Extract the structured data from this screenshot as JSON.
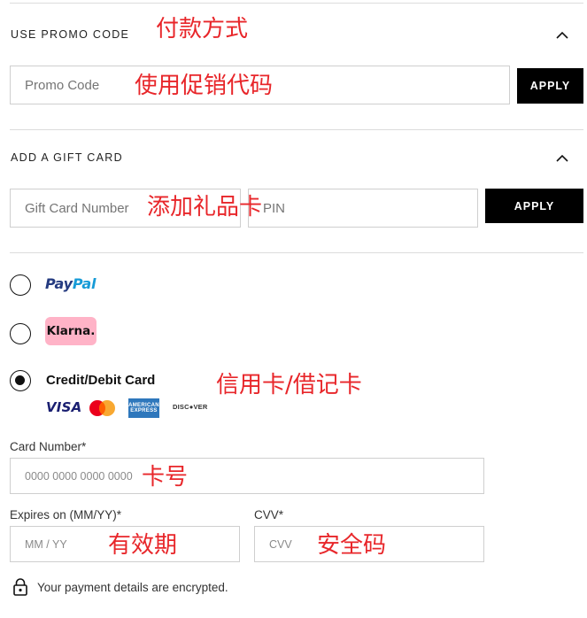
{
  "promo": {
    "title": "USE PROMO CODE",
    "annotation": "付款方式",
    "placeholder": "Promo Code",
    "input_annotation": "使用促销代码",
    "apply_label": "APPLY"
  },
  "gift_card": {
    "title": "ADD A GIFT CARD",
    "number_placeholder": "Gift Card Number",
    "annotation": "添加礼品卡",
    "pin_placeholder": "PIN",
    "apply_label": "APPLY"
  },
  "payment_methods": {
    "paypal": {
      "pay": "Pay",
      "pal": "Pal"
    },
    "klarna": {
      "label": "Klarna."
    },
    "card": {
      "label": "Credit/Debit Card",
      "annotation": "信用卡/借记卡",
      "logos": {
        "visa": "VISA",
        "amex_line1": "AMERICAN",
        "amex_line2": "EXPRESS",
        "discover": "DISC●VER"
      }
    },
    "selected": "card"
  },
  "card_form": {
    "number_label": "Card Number*",
    "number_placeholder": "0000 0000 0000 0000",
    "number_annotation": "卡号",
    "expiry_label": "Expires on (MM/YY)*",
    "expiry_placeholder": "MM / YY",
    "expiry_annotation": "有效期",
    "cvv_label": "CVV*",
    "cvv_placeholder": "CVV",
    "cvv_annotation": "安全码"
  },
  "secure_note": "Your payment details are encrypted.",
  "icons": {
    "chevron": "chevron-up-icon",
    "lock": "lock-icon",
    "mastercard": "mastercard-logo-icon"
  },
  "colors": {
    "annotation": "#e8262a",
    "button": "#000000",
    "paypal_dark": "#253b80",
    "paypal_light": "#179bd7",
    "klarna": "#ffb3c7",
    "amex": "#2e77bc",
    "visa": "#1a1f71"
  }
}
